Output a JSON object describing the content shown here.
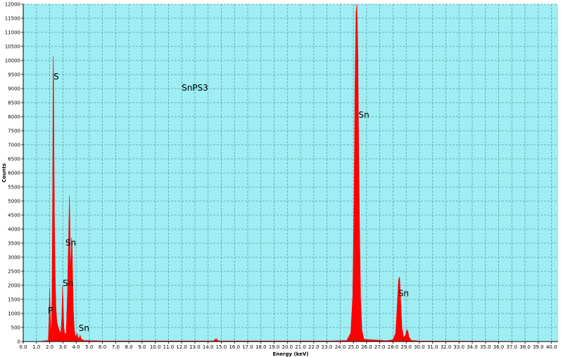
{
  "chart_data": {
    "type": "area",
    "title": "SnPS3",
    "xlabel": "Energy (keV)",
    "ylabel": "Counts",
    "xlim": [
      0,
      40.5
    ],
    "ylim": [
      0,
      12000
    ],
    "x_ticks": [
      "0.0",
      "1.0",
      "2.0",
      "3.0",
      "4.0",
      "5.0",
      "6.0",
      "7.0",
      "8.0",
      "9.0",
      "10.0",
      "11.0",
      "12.0",
      "13.0",
      "14.0",
      "15.0",
      "16.0",
      "17.0",
      "18.0",
      "19.0",
      "20.0",
      "21.0",
      "22.0",
      "23.0",
      "24.0",
      "25.0",
      "26.0",
      "27.0",
      "28.0",
      "29.0",
      "30.0",
      "31.0",
      "32.0",
      "33.0",
      "34.0",
      "35.0",
      "36.0",
      "37.0",
      "38.0",
      "39.0",
      "40.0"
    ],
    "y_ticks": [
      "0",
      "500",
      "1000",
      "1500",
      "2000",
      "2500",
      "3000",
      "3500",
      "4000",
      "4500",
      "5000",
      "5500",
      "6000",
      "6500",
      "7000",
      "7500",
      "8000",
      "8500",
      "9000",
      "9500",
      "10000",
      "10500",
      "11000",
      "11500",
      "12000"
    ],
    "grid": true,
    "colors": {
      "background": "#9eeef3",
      "fill": "#ff0000",
      "grid": "#5a9ea6"
    },
    "spectrum": [
      [
        0.0,
        0
      ],
      [
        1.2,
        0
      ],
      [
        1.9,
        40
      ],
      [
        1.95,
        700
      ],
      [
        2.0,
        1900
      ],
      [
        2.03,
        1300
      ],
      [
        2.06,
        850
      ],
      [
        2.09,
        400
      ],
      [
        2.12,
        300
      ],
      [
        2.18,
        1600
      ],
      [
        2.23,
        5500
      ],
      [
        2.26,
        9400
      ],
      [
        2.28,
        10150
      ],
      [
        2.3,
        9100
      ],
      [
        2.33,
        6700
      ],
      [
        2.37,
        4200
      ],
      [
        2.42,
        2300
      ],
      [
        2.48,
        1200
      ],
      [
        2.55,
        700
      ],
      [
        2.65,
        500
      ],
      [
        2.75,
        380
      ],
      [
        2.85,
        300
      ],
      [
        2.92,
        900
      ],
      [
        2.98,
        2000
      ],
      [
        3.02,
        1400
      ],
      [
        3.08,
        500
      ],
      [
        3.15,
        250
      ],
      [
        3.25,
        300
      ],
      [
        3.35,
        1700
      ],
      [
        3.42,
        3400
      ],
      [
        3.46,
        4300
      ],
      [
        3.5,
        5200
      ],
      [
        3.53,
        4400
      ],
      [
        3.57,
        3100
      ],
      [
        3.62,
        2500
      ],
      [
        3.66,
        3700
      ],
      [
        3.7,
        3500
      ],
      [
        3.75,
        2100
      ],
      [
        3.8,
        1100
      ],
      [
        3.86,
        500
      ],
      [
        3.92,
        250
      ],
      [
        4.0,
        150
      ],
      [
        4.08,
        300
      ],
      [
        4.15,
        150
      ],
      [
        4.25,
        120
      ],
      [
        4.3,
        240
      ],
      [
        4.38,
        100
      ],
      [
        4.6,
        40
      ],
      [
        6.0,
        20
      ],
      [
        14.4,
        20
      ],
      [
        14.6,
        100
      ],
      [
        14.8,
        20
      ],
      [
        23.4,
        20
      ],
      [
        24.5,
        40
      ],
      [
        24.8,
        300
      ],
      [
        24.95,
        1600
      ],
      [
        25.05,
        5000
      ],
      [
        25.12,
        9000
      ],
      [
        25.2,
        11700
      ],
      [
        25.27,
        12000
      ],
      [
        25.34,
        10300
      ],
      [
        25.4,
        7200
      ],
      [
        25.47,
        4000
      ],
      [
        25.55,
        1500
      ],
      [
        25.65,
        400
      ],
      [
        25.8,
        80
      ],
      [
        27.5,
        30
      ],
      [
        28.0,
        60
      ],
      [
        28.2,
        300
      ],
      [
        28.32,
        1300
      ],
      [
        28.42,
        2200
      ],
      [
        28.5,
        2300
      ],
      [
        28.58,
        1500
      ],
      [
        28.68,
        500
      ],
      [
        28.8,
        150
      ],
      [
        28.95,
        220
      ],
      [
        29.05,
        420
      ],
      [
        29.12,
        380
      ],
      [
        29.22,
        150
      ],
      [
        29.4,
        40
      ],
      [
        30.0,
        20
      ],
      [
        40.5,
        0
      ]
    ],
    "annotations": [
      {
        "text": "SnPS3",
        "x": 13.0,
        "y": 8930
      },
      {
        "text": "S",
        "x": 2.5,
        "y": 9320
      },
      {
        "text": "Sn",
        "x": 25.8,
        "y": 7960
      },
      {
        "text": "Sn",
        "x": 3.6,
        "y": 3410
      },
      {
        "text": "Sn",
        "x": 3.4,
        "y": 1970
      },
      {
        "text": "P",
        "x": 2.05,
        "y": 1000
      },
      {
        "text": "Sn",
        "x": 4.6,
        "y": 380
      },
      {
        "text": "Sn",
        "x": 28.8,
        "y": 1610
      }
    ]
  }
}
